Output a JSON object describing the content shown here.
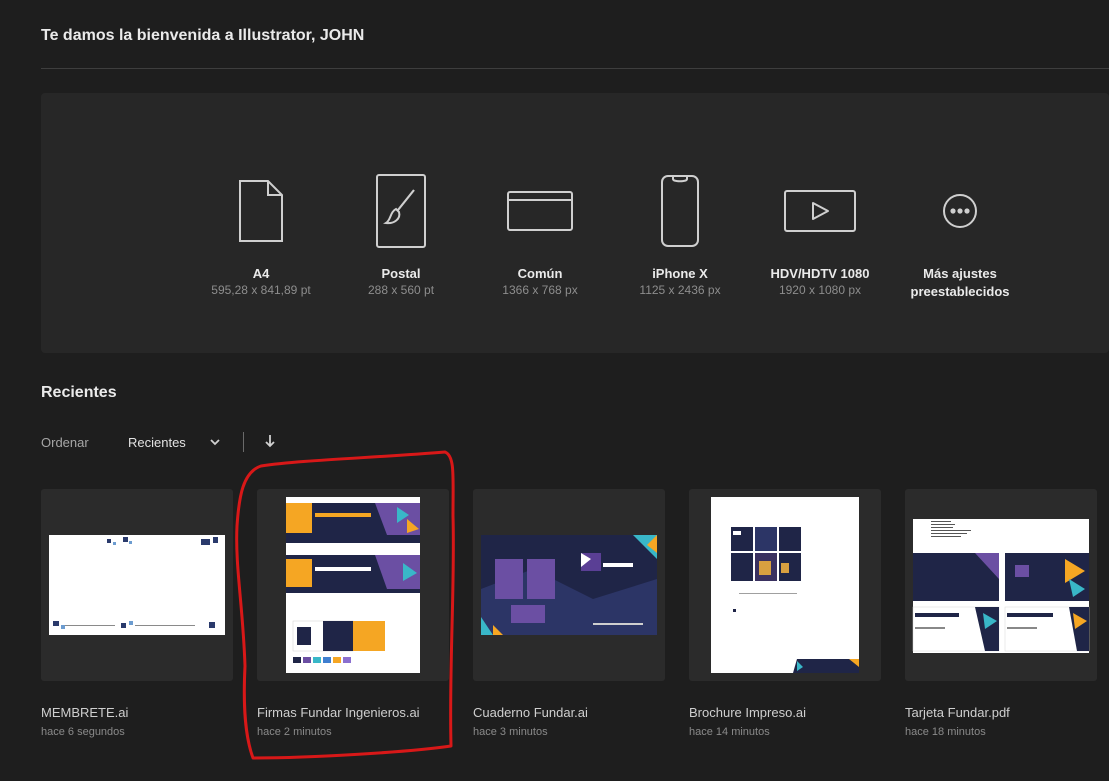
{
  "header": {
    "welcome": "Te damos la bienvenida a Illustrator, JOHN"
  },
  "presets": [
    {
      "name": "A4",
      "size": "595,28 x 841,89 pt",
      "icon": "document-icon"
    },
    {
      "name": "Postal",
      "size": "288 x 560 pt",
      "icon": "postcard-brush-icon"
    },
    {
      "name": "Común",
      "size": "1366 x 768 px",
      "icon": "browser-window-icon"
    },
    {
      "name": "iPhone X",
      "size": "1125 x 2436 px",
      "icon": "phone-icon"
    },
    {
      "name": "HDV/HDTV 1080",
      "size": "1920 x 1080 px",
      "icon": "video-play-icon"
    },
    {
      "name_line1": "Más ajustes",
      "name_line2": "preestablecidos",
      "icon": "more-icon"
    }
  ],
  "recents": {
    "title": "Recientes",
    "sort_label": "Ordenar",
    "sort_value": "Recientes",
    "files": [
      {
        "name": "MEMBRETE.ai",
        "time": "hace 6 segundos"
      },
      {
        "name": "Firmas Fundar Ingenieros.ai",
        "time": "hace 2 minutos"
      },
      {
        "name": "Cuaderno Fundar.ai",
        "time": "hace 3 minutos"
      },
      {
        "name": "Brochure Impreso.ai",
        "time": "hace 14 minutos"
      },
      {
        "name": "Tarjeta Fundar.pdf",
        "time": "hace 18 minutos"
      }
    ]
  },
  "colors": {
    "background": "#1e1e1e",
    "panel": "#272727",
    "thumb_bg": "#2b2b2b",
    "brand_navy": "#1f2547",
    "brand_orange": "#f5a623",
    "brand_purple": "#6b4fa3",
    "annotation_red": "#d81818"
  }
}
